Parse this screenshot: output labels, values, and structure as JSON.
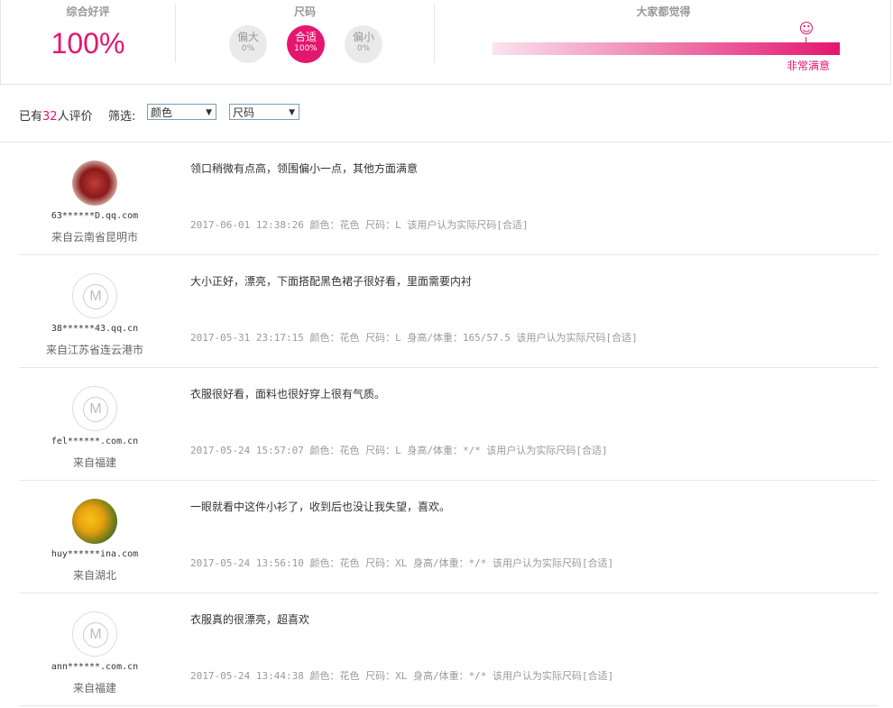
{
  "summary": {
    "rating_title": "综合好评",
    "rating_value": "100%",
    "size_title": "尺码",
    "size_options": [
      {
        "label": "偏大",
        "percent": "0%",
        "active": false
      },
      {
        "label": "合适",
        "percent": "100%",
        "active": true
      },
      {
        "label": "偏小",
        "percent": "0%",
        "active": false
      }
    ],
    "feel_title": "大家都觉得",
    "feel_label": "非常满意",
    "feel_level": 1.0,
    "accent_color": "#e4166e"
  },
  "filter": {
    "count_prefix": "已有",
    "count": "32",
    "count_suffix": "人评价",
    "filter_label": "筛选:",
    "color_select": "颜色",
    "size_select": "尺码"
  },
  "reviews": [
    {
      "user": "63******D.qq.com",
      "location": "来自云南省昆明市",
      "avatar": "photo-red",
      "text": "领口稍微有点高，领围偏小一点，其他方面满意",
      "meta": "2017-06-01 12:38:26 颜色：花色 尺码：L 该用户认为实际尺码[合适]"
    },
    {
      "user": "38******43.qq.cn",
      "location": "来自江苏省连云港市",
      "avatar": "default-m",
      "text": "大小正好，漂亮，下面搭配黑色裙子很好看，里面需要内衬",
      "meta": "2017-05-31 23:17:15 颜色：花色 尺码：L 身高/体重：165/57.5 该用户认为实际尺码[合适]"
    },
    {
      "user": "fel******.com.cn",
      "location": "来自福建",
      "avatar": "default-m",
      "text": "衣服很好看，面料也很好穿上很有气质。",
      "meta": "2017-05-24 15:57:07 颜色：花色 尺码：L 身高/体重：*/* 该用户认为实际尺码[合适]"
    },
    {
      "user": "huy******ina.com",
      "location": "来自湖北",
      "avatar": "photo-flower",
      "text": "一眼就看中这件小衫了，收到后也没让我失望，喜欢。",
      "meta": "2017-05-24 13:56:10 颜色：花色 尺码：XL 身高/体重：*/* 该用户认为实际尺码[合适]"
    },
    {
      "user": "ann******.com.cn",
      "location": "来自福建",
      "avatar": "default-m",
      "text": "衣服真的很漂亮，超喜欢",
      "meta": "2017-05-24 13:44:38 颜色：花色 尺码：XL 身高/体重：*/* 该用户认为实际尺码[合适]"
    }
  ]
}
